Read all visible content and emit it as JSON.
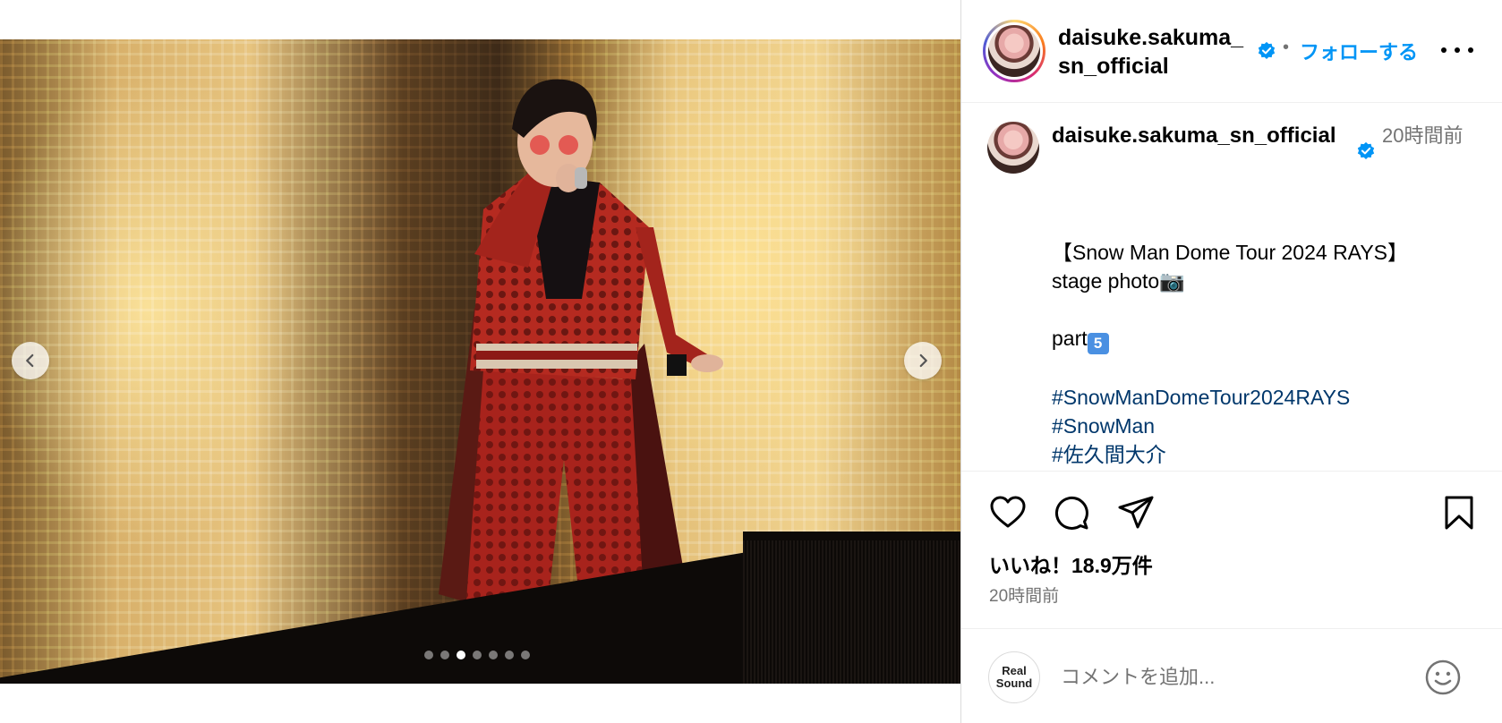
{
  "post": {
    "username": "daisuke.sakuma_sn_official",
    "follow_label": "フォローする",
    "separator": "•",
    "more_label": "その他",
    "carousel": {
      "total_slides": 7,
      "active_index": 2
    }
  },
  "caption": {
    "username": "daisuke.sakuma_sn_official",
    "time": "20時間前",
    "lines": [
      {
        "text": "【Snow Man Dome Tour 2024 RAYS】",
        "type": "text"
      },
      {
        "text": "stage photo📷",
        "type": "text"
      },
      {
        "text": "",
        "type": "blank"
      },
      {
        "text": "part",
        "type": "text",
        "emoji": "5"
      },
      {
        "text": "",
        "type": "blank"
      },
      {
        "text": "#SnowManDomeTour2024RAYS",
        "type": "tag"
      },
      {
        "text": "#SnowMan",
        "type": "tag"
      },
      {
        "text": "#佐久間大介",
        "type": "tag"
      }
    ]
  },
  "actions": {
    "likes_label": "いいね！18.9万件",
    "timestamp": "20時間前"
  },
  "comment_box": {
    "avatar_line1": "Real",
    "avatar_line2": "Sound",
    "placeholder": "コメントを追加..."
  },
  "colors": {
    "accent": "#0095f6",
    "verified": "#0095f6",
    "hashtag": "#00376b",
    "muted": "#737373"
  },
  "icons": [
    "chevron-left-icon",
    "chevron-right-icon",
    "verified-icon",
    "more-icon",
    "heart-icon",
    "comment-icon",
    "share-icon",
    "bookmark-icon",
    "emoji-icon"
  ]
}
